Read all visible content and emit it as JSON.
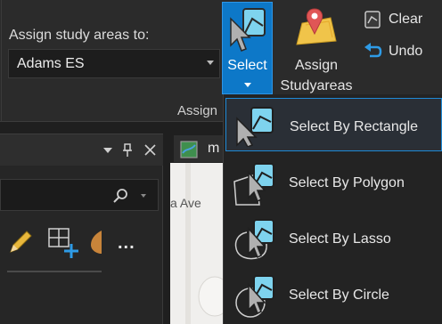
{
  "ribbon": {
    "assign_label": "Assign study areas to:",
    "combo_value": "Adams ES",
    "group_label": "Assign",
    "select_button": "Select",
    "assign_button_line1": "Assign",
    "assign_button_line2": "Studyareas",
    "clear_button": "Clear",
    "undo_button": "Undo"
  },
  "left_pane": {
    "more_label": "..."
  },
  "map": {
    "tab_label": "m",
    "street_label": "a Ave"
  },
  "menu": {
    "items": [
      {
        "label": "Select By Rectangle",
        "icon": "select-rectangle-icon",
        "active": true
      },
      {
        "label": "Select By Polygon",
        "icon": "select-polygon-icon",
        "active": false
      },
      {
        "label": "Select By Lasso",
        "icon": "select-lasso-icon",
        "active": false
      },
      {
        "label": "Select By Circle",
        "icon": "select-circle-icon",
        "active": false
      }
    ]
  },
  "colors": {
    "accent": "#0d78c8",
    "ribbon_bg": "#2b2b2b",
    "menu_bg": "#232323"
  }
}
